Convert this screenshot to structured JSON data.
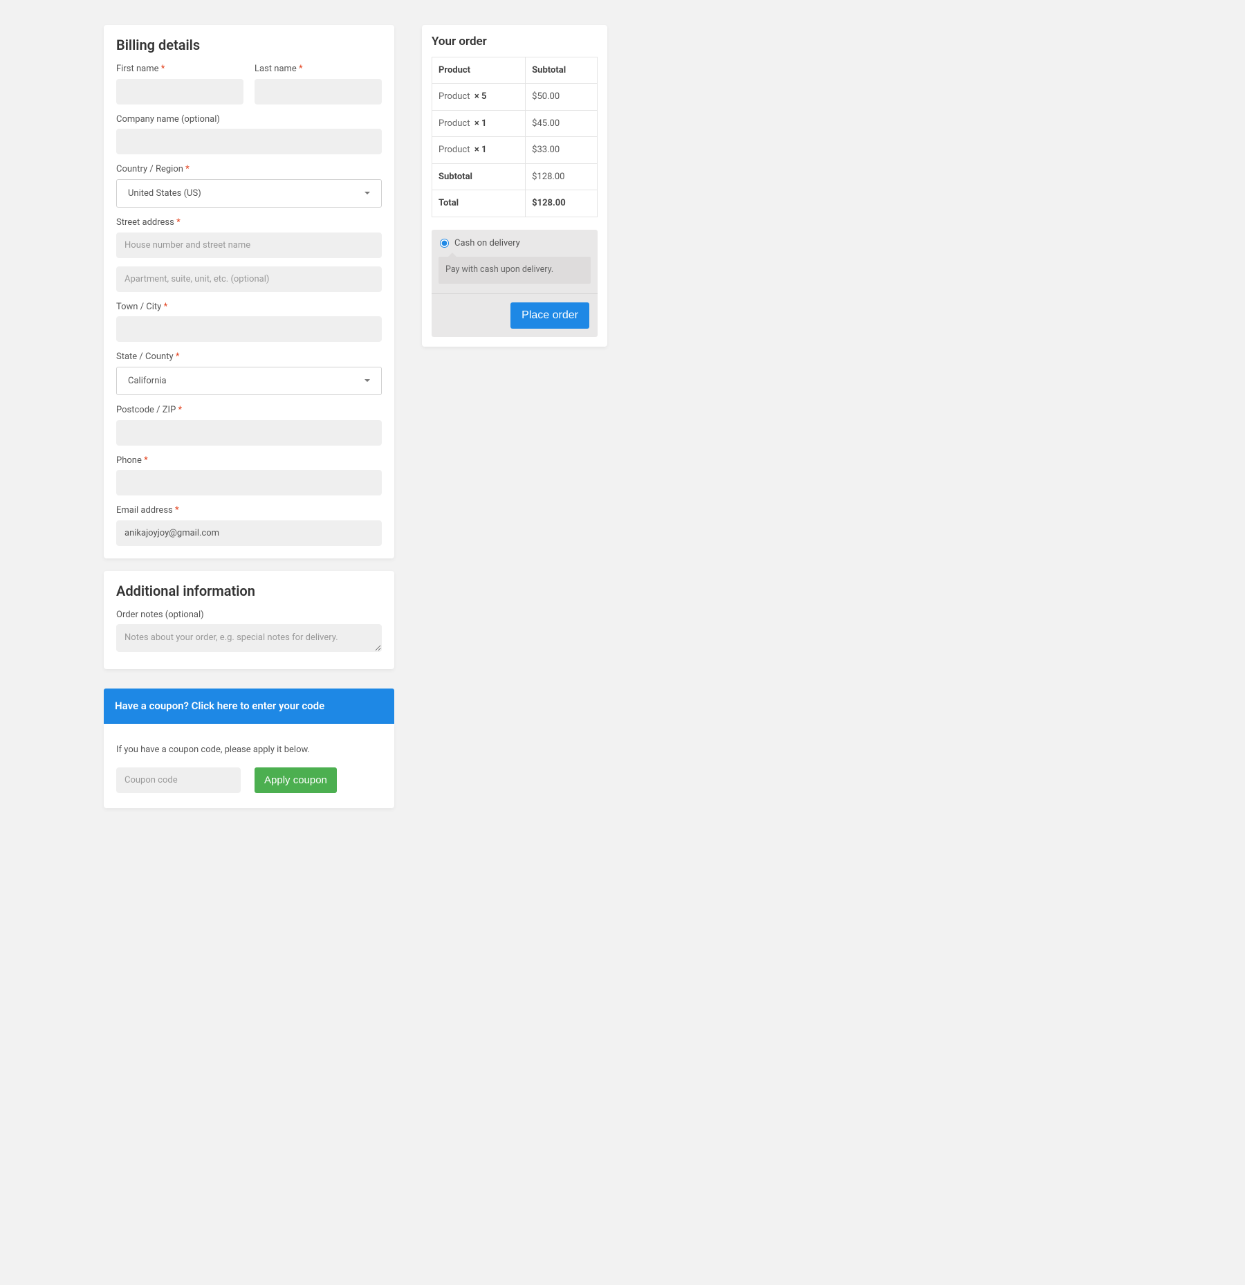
{
  "billing": {
    "title": "Billing details",
    "first_name_label": "First name",
    "last_name_label": "Last name",
    "company_label": "Company name (optional)",
    "country_label": "Country / Region",
    "country_value": "United States (US)",
    "street_label": "Street address",
    "street_placeholder": "House number and street name",
    "street2_placeholder": "Apartment, suite, unit, etc. (optional)",
    "city_label": "Town / City",
    "state_label": "State / County",
    "state_value": "California",
    "postcode_label": "Postcode / ZIP",
    "phone_label": "Phone",
    "email_label": "Email address",
    "email_value": "anikajoyjoy@gmail.com",
    "required_mark": "*"
  },
  "additional": {
    "title": "Additional information",
    "notes_label": "Order notes (optional)",
    "notes_placeholder": "Notes about your order, e.g. special notes for delivery."
  },
  "coupon": {
    "banner": "Have a coupon? Click here to enter your code",
    "instruction": "If you have a coupon code, please apply it below.",
    "placeholder": "Coupon code",
    "apply_label": "Apply coupon"
  },
  "order": {
    "title": "Your order",
    "col_product": "Product",
    "col_subtotal": "Subtotal",
    "items": [
      {
        "name": "Product",
        "qty": "× 5",
        "subtotal": "$50.00"
      },
      {
        "name": "Product",
        "qty": "× 1",
        "subtotal": "$45.00"
      },
      {
        "name": "Product",
        "qty": "× 1",
        "subtotal": "$33.00"
      }
    ],
    "subtotal_label": "Subtotal",
    "subtotal_value": "$128.00",
    "total_label": "Total",
    "total_value": "$128.00"
  },
  "payment": {
    "method_label": "Cash on delivery",
    "method_desc": "Pay with cash upon delivery.",
    "place_order_label": "Place order"
  }
}
